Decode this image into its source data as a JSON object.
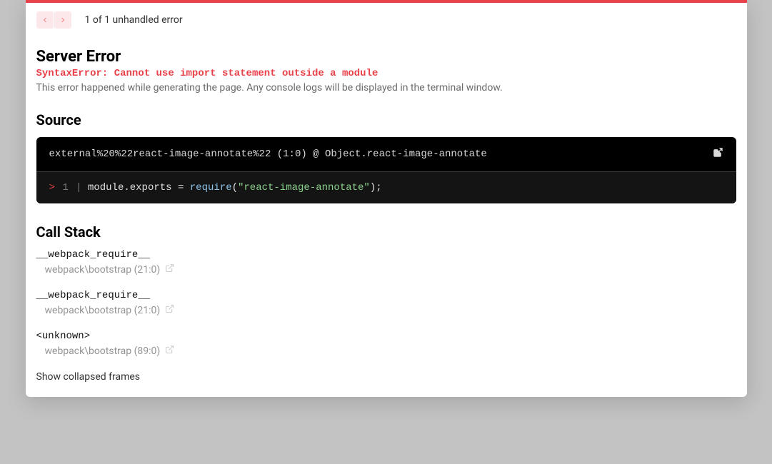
{
  "nav": {
    "error_count_text": "1 of 1 unhandled error"
  },
  "header": {
    "title": "Server Error",
    "error_message": "SyntaxError: Cannot use import statement outside a module",
    "subtext": "This error happened while generating the page. Any console logs will be displayed in the terminal window."
  },
  "source": {
    "section_title": "Source",
    "location_text": "external%20%22react-image-annotate%22 (1:0) @ Object.react-image-annotate",
    "code": {
      "sign": ">",
      "line_number": "1",
      "pipe": "|",
      "segments": {
        "module_exports": "module.exports",
        "space1": " ",
        "equals": "=",
        "space2": " ",
        "require": "require",
        "lparen": "(",
        "string": "\"react-image-annotate\"",
        "rparen": ")",
        "semi": ";"
      }
    }
  },
  "callstack": {
    "section_title": "Call Stack",
    "frames": [
      {
        "fn": "__webpack_require__",
        "loc": "webpack\\bootstrap (21:0)"
      },
      {
        "fn": "__webpack_require__",
        "loc": "webpack\\bootstrap (21:0)"
      },
      {
        "fn": "<unknown>",
        "loc": "webpack\\bootstrap (89:0)"
      }
    ],
    "show_collapsed": "Show collapsed frames"
  }
}
